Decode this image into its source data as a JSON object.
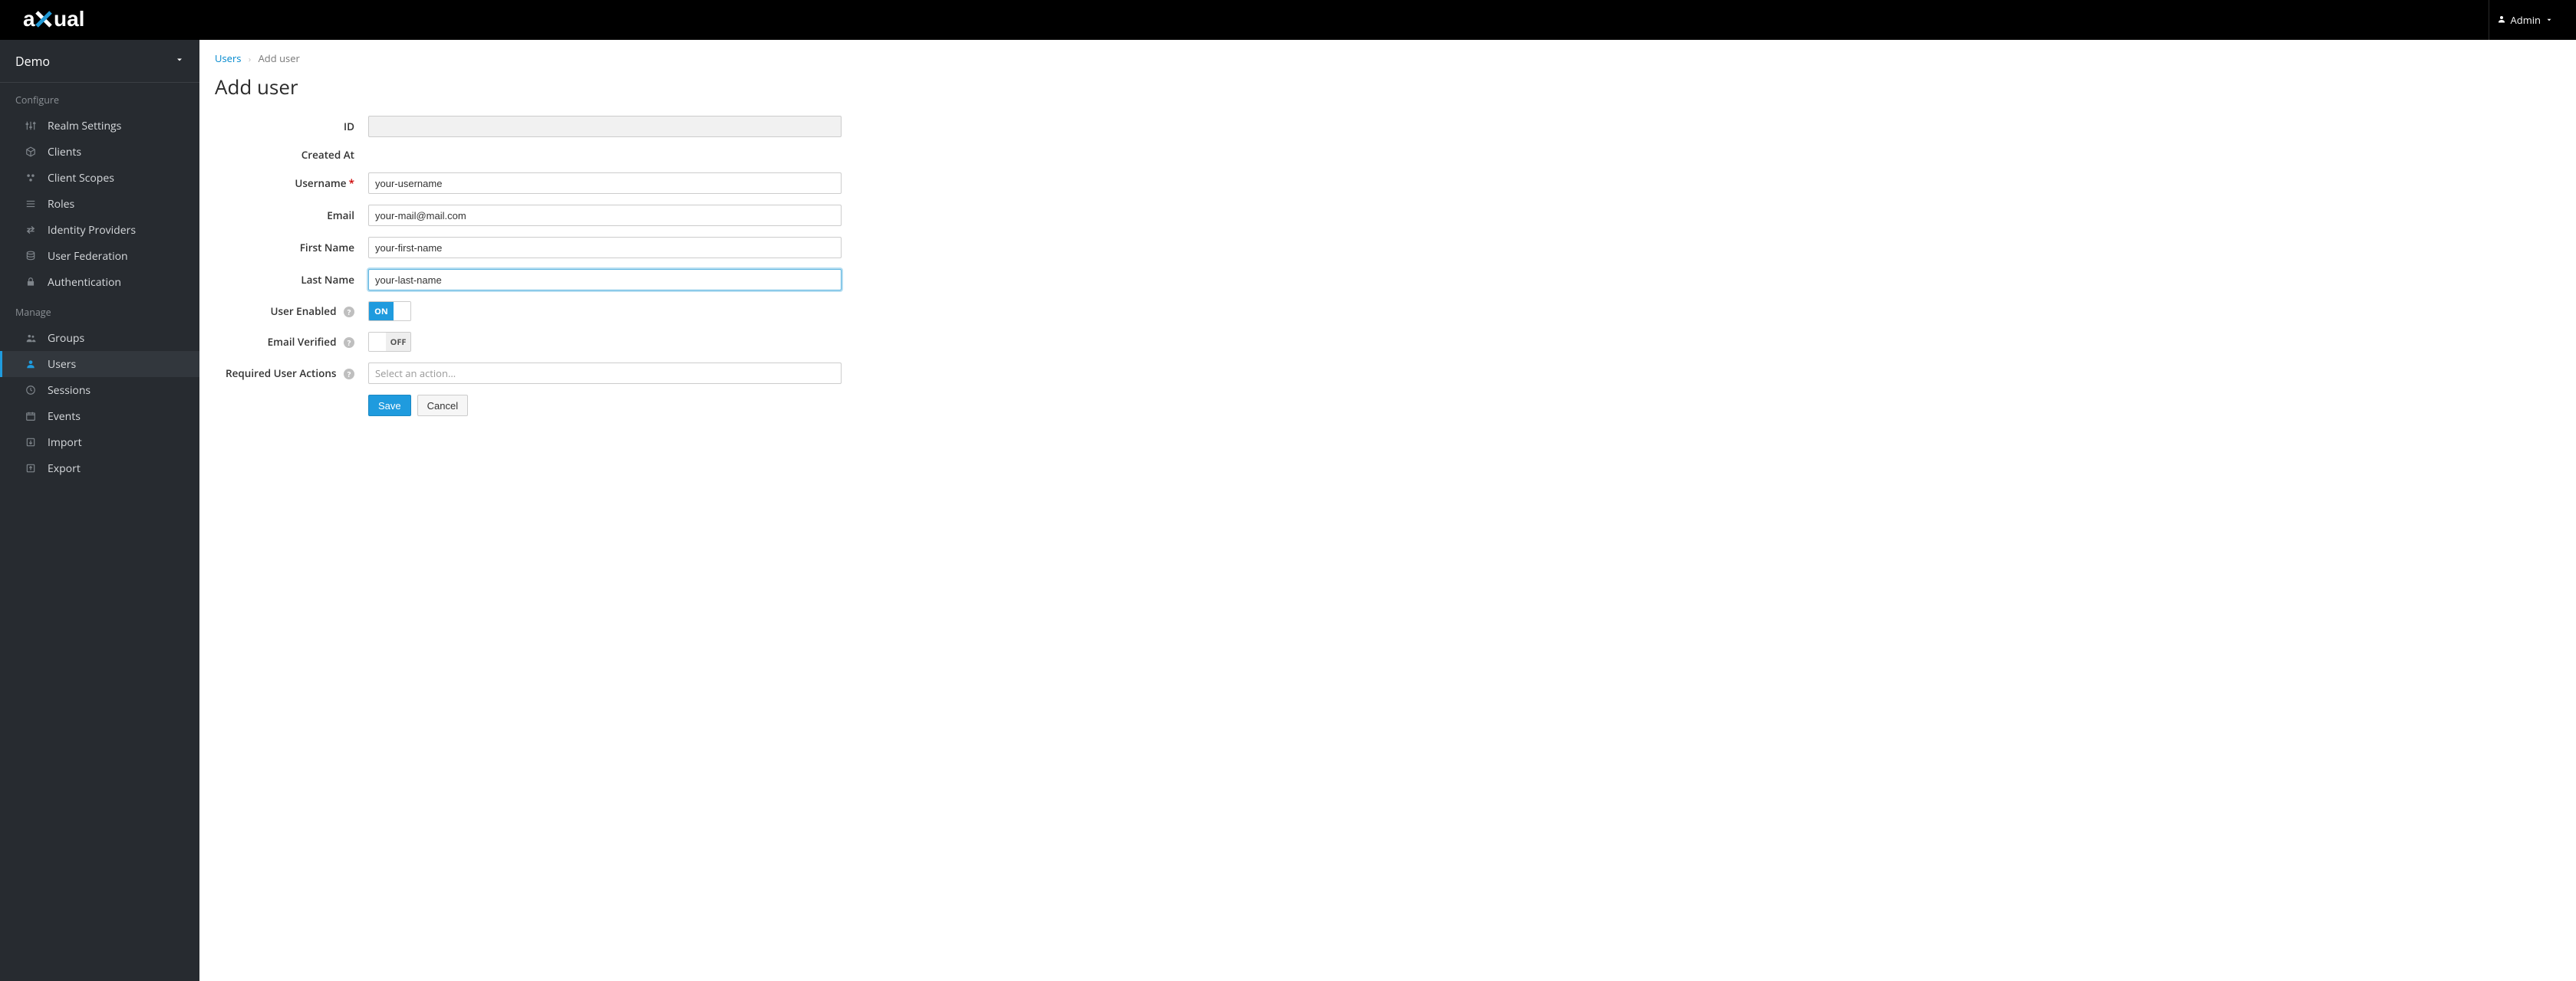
{
  "header": {
    "logo_text": "axual",
    "user_label": "Admin"
  },
  "sidebar": {
    "realm_name": "Demo",
    "groups": [
      {
        "title": "Configure",
        "items": [
          {
            "label": "Realm Settings",
            "icon": "sliders-icon"
          },
          {
            "label": "Clients",
            "icon": "cube-icon"
          },
          {
            "label": "Client Scopes",
            "icon": "scopes-icon"
          },
          {
            "label": "Roles",
            "icon": "list-icon"
          },
          {
            "label": "Identity Providers",
            "icon": "exchange-icon"
          },
          {
            "label": "User Federation",
            "icon": "database-icon"
          },
          {
            "label": "Authentication",
            "icon": "lock-icon"
          }
        ]
      },
      {
        "title": "Manage",
        "items": [
          {
            "label": "Groups",
            "icon": "group-icon"
          },
          {
            "label": "Users",
            "icon": "user-icon",
            "active": true
          },
          {
            "label": "Sessions",
            "icon": "clock-icon"
          },
          {
            "label": "Events",
            "icon": "calendar-icon"
          },
          {
            "label": "Import",
            "icon": "import-icon"
          },
          {
            "label": "Export",
            "icon": "export-icon"
          }
        ]
      }
    ]
  },
  "breadcrumb": {
    "parent": "Users",
    "current": "Add user"
  },
  "page": {
    "title": "Add user"
  },
  "form": {
    "id_label": "ID",
    "id_value": "",
    "created_at_label": "Created At",
    "created_at_value": "",
    "username_label": "Username",
    "username_value": "your-username",
    "email_label": "Email",
    "email_value": "your-mail@mail.com",
    "first_name_label": "First Name",
    "first_name_value": "your-first-name",
    "last_name_label": "Last Name",
    "last_name_value": "your-last-name",
    "user_enabled_label": "User Enabled",
    "user_enabled_on": "ON",
    "user_enabled_value": true,
    "email_verified_label": "Email Verified",
    "email_verified_off": "OFF",
    "email_verified_value": false,
    "required_actions_label": "Required User Actions",
    "required_actions_placeholder": "Select an action...",
    "save_label": "Save",
    "cancel_label": "Cancel"
  }
}
